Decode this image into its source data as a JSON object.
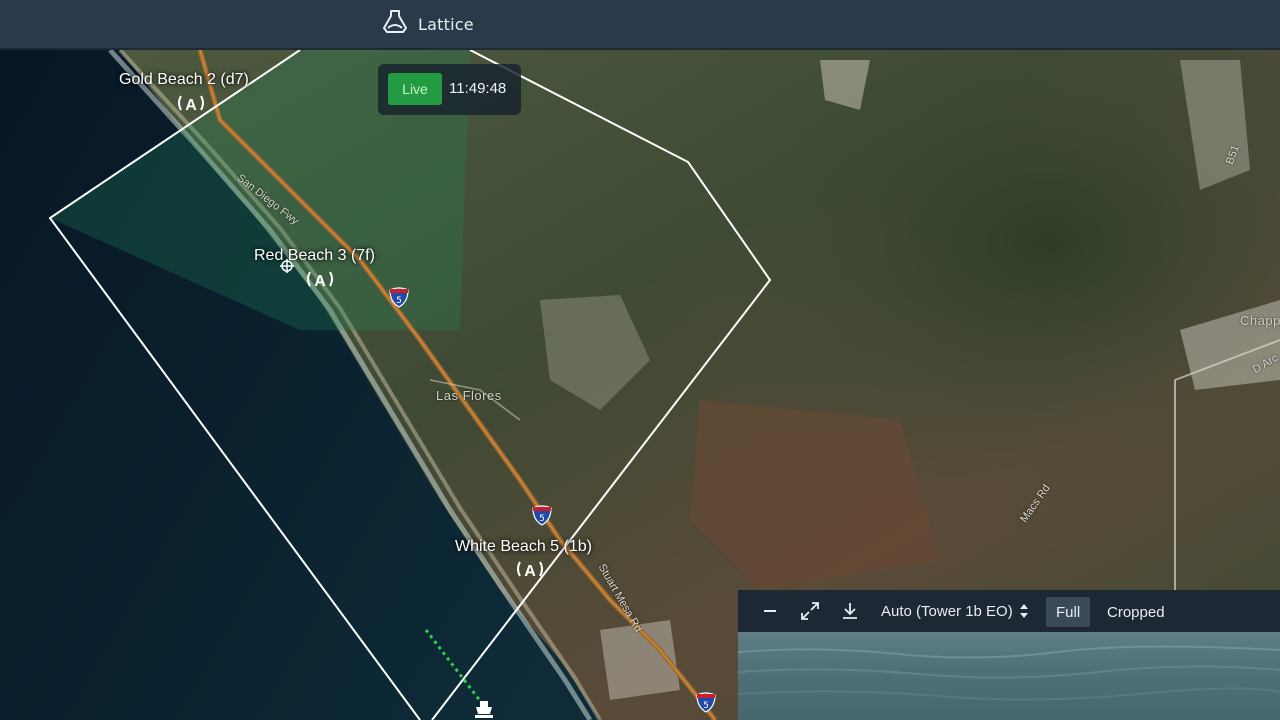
{
  "app": {
    "title": "Lattice",
    "logo_icon": "lattice-logo-icon"
  },
  "live": {
    "badge": "Live",
    "time": "11:49:48",
    "badge_color": "#239b43"
  },
  "sites": [
    {
      "label": "Gold Beach 2 (d7)",
      "icon": "antenna-icon"
    },
    {
      "label": "Red Beach 3 (7f)",
      "icon": "antenna-icon"
    },
    {
      "label": "White Beach 5 (1b)",
      "icon": "antenna-icon"
    }
  ],
  "places": {
    "las_flores": "Las Flores",
    "chapp": "Chapp",
    "d_arc": "D Arc"
  },
  "roads": {
    "san_diego_fwy": "San Diego Fwy",
    "stuart_mesa": "Stuart Mesa Rd",
    "macs": "Macs Rd",
    "b51": "B51"
  },
  "highway": {
    "shield": "5"
  },
  "camera": {
    "source_select": "Auto (Tower 1b EO)",
    "tabs": [
      "Full",
      "Cropped"
    ],
    "active_tab": "Full",
    "icons": {
      "minimize": "minimize-icon",
      "expand": "expand-icon",
      "download": "download-icon",
      "sort": "sort-arrows-icon"
    }
  },
  "colors": {
    "header": "#2a3a4b",
    "zone_outline": "#ffffff",
    "track_dots": "#2bd34a",
    "panel": "#1c2833"
  }
}
